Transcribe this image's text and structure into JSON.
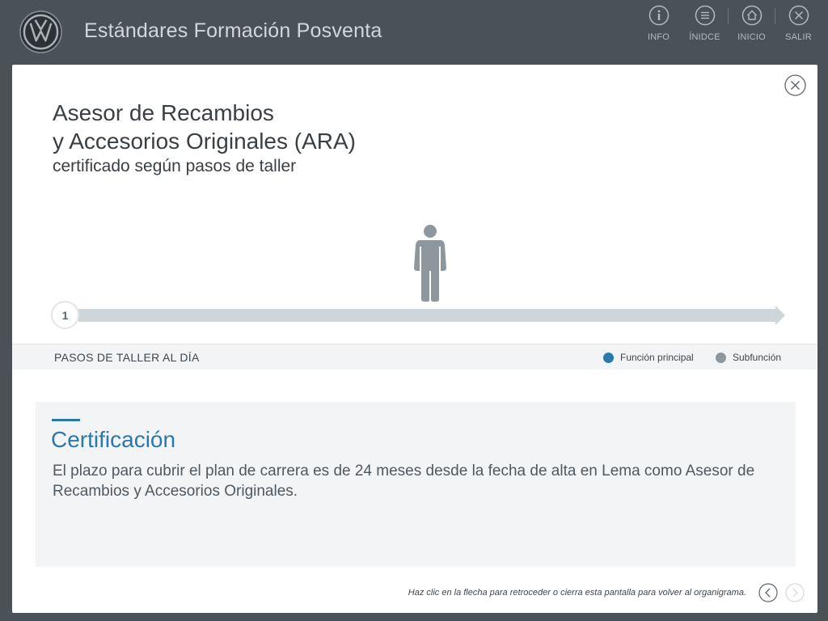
{
  "header": {
    "app_title": "Estándares Formación Posventa",
    "nav": [
      {
        "label": "INFO",
        "icon": "info-icon"
      },
      {
        "label": "ÍNIDCE",
        "icon": "list-icon"
      },
      {
        "label": "INICIO",
        "icon": "home-icon"
      },
      {
        "label": "SALIR",
        "icon": "close-icon"
      }
    ]
  },
  "modal": {
    "title_line1": "Asesor de Recambios",
    "title_line2": "y Accesorios Originales (ARA)",
    "subtitle": "certificado según pasos de taller",
    "step_number": "1",
    "legend": {
      "title": "PASOS DE TALLER AL DÍA",
      "items": [
        {
          "label": "Función principal",
          "color": "#2a79ad"
        },
        {
          "label": "Subfunción",
          "color": "#8e979e"
        }
      ]
    },
    "info": {
      "title": "Certificación",
      "text": "El plazo para cubrir el plan de carrera es de 24 meses desde la fecha de alta en Lema como Asesor de Recambios y Accesorios Originales."
    },
    "footer_hint": "Haz clic en la flecha para retroceder o cierra esta pantalla para volver al organigrama."
  }
}
